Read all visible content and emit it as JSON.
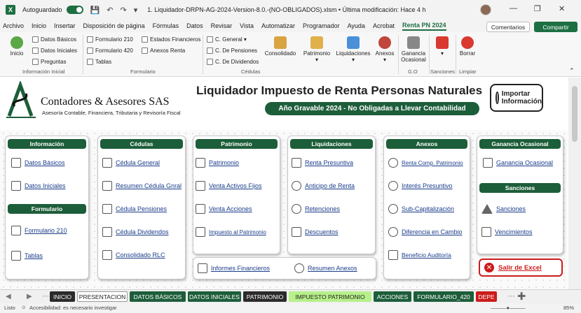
{
  "titlebar": {
    "autosave_label": "Autoguardado",
    "doc_title": "1. Liquidador-DRPN-AG-2024-Version-8.0.-(NO-OBLIGADOS).xlsm  •  Última modificación: Hace 4 h"
  },
  "menu": [
    "Archivo",
    "Inicio",
    "Insertar",
    "Disposición de página",
    "Fórmulas",
    "Datos",
    "Revisar",
    "Vista",
    "Automatizar",
    "Programador",
    "Ayuda",
    "Acrobat",
    "Renta PN 2024"
  ],
  "menu_active_index": 12,
  "comentarios_label": "Comentarios",
  "compartir_label": "Compartir",
  "ribbon": {
    "inicio": "Inicio",
    "datos_basicos": "Datos Básicos",
    "datos_iniciales": "Datos Iniciales",
    "preguntas": "Preguntas",
    "group_informacion": "Información Inicial",
    "formulario_210": "Formulario 210",
    "formulario_420": "Formulario 420",
    "tablas": "Tablas",
    "estados_financieros": "Estados Financieros",
    "anexos_renta": "Anexos Renta",
    "group_formulario": "Formulario",
    "c_general": "C. General",
    "c_pensiones": "C. De Pensiones",
    "c_dividendos": "C. De Dividendos",
    "consolidado": "Consolidado",
    "patrimonio": "Patrimonio",
    "liquidaciones": "Liquidaciones",
    "anexos": "Anexos",
    "group_cedulas": "Cédulas",
    "ganancia": "Ganancia Ocasional",
    "group_go": "G.O",
    "group_sanciones": "Sanciones",
    "borrar": "Borrar",
    "group_limpiar": "Limpiar"
  },
  "brand": {
    "name": "Contadores & Asesores SAS",
    "subtitle": "Asesoría Contable, Financiera, Tributaria y Revisoría Fiscal"
  },
  "header": {
    "title": "Liquidador Impuesto de Renta Personas Naturales",
    "subtitle": "Año Gravable 2024 - No Obligadas a Llevar Contabilidad",
    "import_label_1": "Importar",
    "import_label_2": "Información"
  },
  "cards": {
    "informacion": {
      "title": "Información",
      "items": [
        "Datos Básicos",
        "Datos Iniciales"
      ]
    },
    "formulario": {
      "title": "Formulario",
      "items": [
        "Formulario 210",
        "Tablas"
      ]
    },
    "cedulas": {
      "title": "Cédulas",
      "items": [
        "Cédula General",
        "Resumen Cédula Gnral",
        "Cédula Pensiones",
        "Cédula Dividendos",
        "Consolidado RLC"
      ]
    },
    "patrimonio": {
      "title": "Patrimonio",
      "items": [
        "Patrimonio",
        "Venta Activos Fijos",
        "Venta Acciones",
        "Impuesto al Patrimonio"
      ]
    },
    "liquidaciones": {
      "title": "Liquidaciones",
      "items": [
        "Renta Presuntiva",
        "Anticipo de Renta",
        "Retenciones",
        "Descuentos"
      ]
    },
    "anexos": {
      "title": "Anexos",
      "items": [
        "Renta Comp. Patrimonio",
        "Interés Presuntivo",
        "Sub-Capitalización",
        "Diferencia en Cambio",
        "Beneficio Auditoría"
      ]
    },
    "ganancia": {
      "title": "Ganancia Ocasional",
      "items": [
        "Ganancia Ocasional"
      ]
    },
    "sanciones": {
      "title": "Sanciones",
      "items": [
        "Sanciones",
        "Vencimientos"
      ]
    },
    "bottom": {
      "items": [
        "Informes Financieros",
        "Resumen Anexos"
      ]
    }
  },
  "salir_label": "Salir de Excel",
  "sheet_tabs": [
    {
      "label": "INICIO",
      "bg": "#2b2b2b",
      "fg": "#ffffff"
    },
    {
      "label": "PRESENTACION",
      "bg": "#ffffff",
      "fg": "#222222"
    },
    {
      "label": "DATOS BÁSICOS",
      "bg": "#1d5e3a",
      "fg": "#ffffff"
    },
    {
      "label": "DATOS INICIALES",
      "bg": "#1d5e3a",
      "fg": "#ffffff"
    },
    {
      "label": "PATRIMONIO",
      "bg": "#2b2b2b",
      "fg": "#ffffff"
    },
    {
      "label": "IMPUESTO PATRIMONIO",
      "bg": "#b7f08a",
      "fg": "#222222"
    },
    {
      "label": "ACCIONES",
      "bg": "#1d5e3a",
      "fg": "#ffffff"
    },
    {
      "label": "FORMULARIO_420",
      "bg": "#1d5e3a",
      "fg": "#ffffff"
    },
    {
      "label": "DEPE",
      "bg": "#cc1b1b",
      "fg": "#ffffff"
    }
  ],
  "status": {
    "listo": "Listo",
    "accesibilidad": "Accesibilidad: es necesario investigar",
    "zoom": "85%"
  },
  "colors": {
    "accent": "#1d6f42",
    "header_green": "#1d5e3a",
    "link_blue": "#1a3d8a",
    "exit_red": "#cc1b1b"
  }
}
